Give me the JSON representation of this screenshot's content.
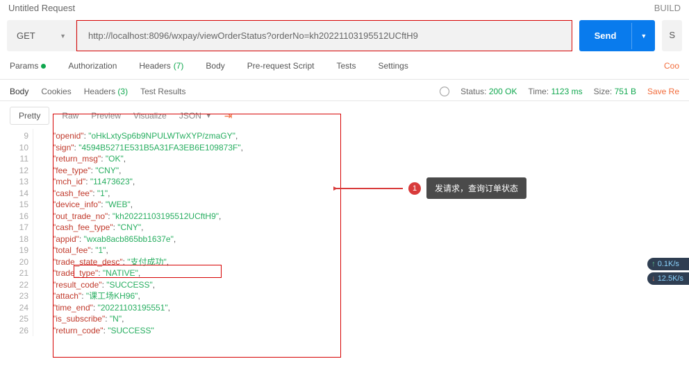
{
  "title": "Untitled Request",
  "build_label": "BUILD",
  "request": {
    "method": "GET",
    "url": "http://localhost:8096/wxpay/viewOrderStatus?orderNo=kh20221103195512UCftH9",
    "send_label": "Send",
    "aux_label": "S"
  },
  "req_tabs": {
    "params": "Params",
    "auth": "Authorization",
    "headers": "Headers",
    "headers_count": "(7)",
    "body": "Body",
    "prereq": "Pre-request Script",
    "tests": "Tests",
    "settings": "Settings",
    "cookies": "Coo"
  },
  "res_tabs": {
    "body": "Body",
    "cookies": "Cookies",
    "headers": "Headers",
    "headers_count": "(3)",
    "test_results": "Test Results"
  },
  "status": {
    "status_label": "Status:",
    "status_val": "200 OK",
    "time_label": "Time:",
    "time_val": "1123 ms",
    "size_label": "Size:",
    "size_val": "751 B",
    "save_label": "Save Re"
  },
  "view": {
    "pretty": "Pretty",
    "raw": "Raw",
    "preview": "Preview",
    "visualize": "Visualize",
    "json": "JSON"
  },
  "lines": [
    "9",
    "10",
    "11",
    "12",
    "13",
    "14",
    "15",
    "16",
    "17",
    "18",
    "19",
    "20",
    "21",
    "22",
    "23",
    "24",
    "25",
    "26"
  ],
  "json_rows": [
    {
      "k": "openid",
      "v": "oHkLxtySp6b9NPULWTwXYP/zmaGY",
      "c": ","
    },
    {
      "k": "sign",
      "v": "4594B5271E531B5A31FA3EB6E109873F",
      "c": ","
    },
    {
      "k": "return_msg",
      "v": "OK",
      "c": ","
    },
    {
      "k": "fee_type",
      "v": "CNY",
      "c": ","
    },
    {
      "k": "mch_id",
      "v": "11473623",
      "c": ","
    },
    {
      "k": "cash_fee",
      "v": "1",
      "c": ","
    },
    {
      "k": "device_info",
      "v": "WEB",
      "c": ","
    },
    {
      "k": "out_trade_no",
      "v": "kh20221103195512UCftH9",
      "c": ","
    },
    {
      "k": "cash_fee_type",
      "v": "CNY",
      "c": ","
    },
    {
      "k": "appid",
      "v": "wxab8acb865bb1637e",
      "c": ","
    },
    {
      "k": "total_fee",
      "v": "1",
      "c": ","
    },
    {
      "k": "trade_state_desc",
      "v": "支付成功",
      "c": ","
    },
    {
      "k": "trade_type",
      "v": "NATIVE",
      "c": ","
    },
    {
      "k": "result_code",
      "v": "SUCCESS",
      "c": ","
    },
    {
      "k": "attach",
      "v": "课工场KH96",
      "c": ","
    },
    {
      "k": "time_end",
      "v": "20221103195551",
      "c": ","
    },
    {
      "k": "is_subscribe",
      "v": "N",
      "c": ","
    },
    {
      "k": "return_code",
      "v": "SUCCESS",
      "c": ""
    }
  ],
  "annotation": {
    "num": "1",
    "text": "发请求，查询订单状态"
  },
  "perf": {
    "up": "0.1K/s",
    "down": "12.5K/s"
  }
}
